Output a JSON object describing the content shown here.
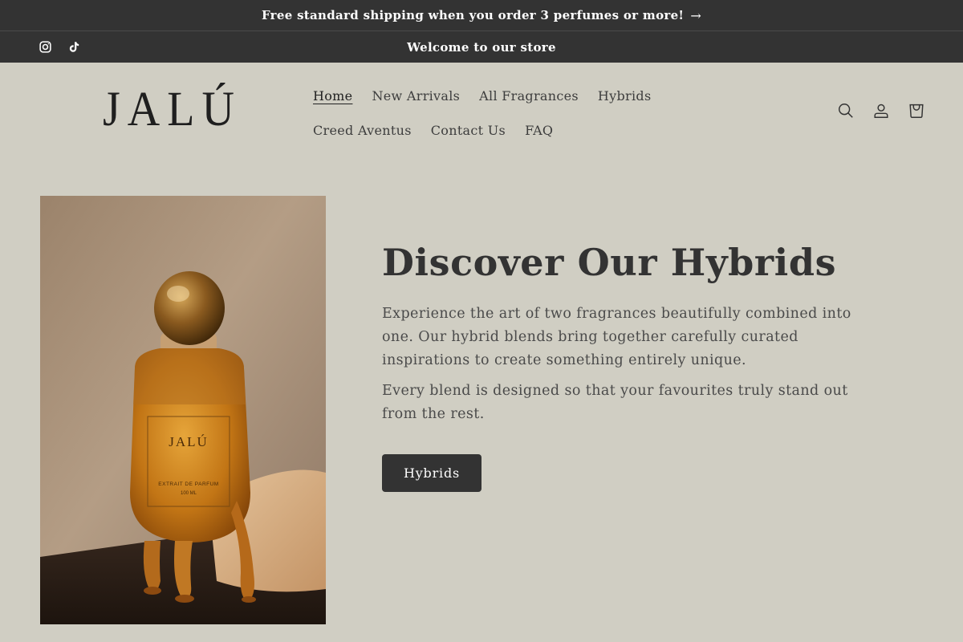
{
  "announcement": {
    "text": "Free standard shipping when you order 3 perfumes or more!",
    "arrow": "→"
  },
  "welcome_bar": {
    "text": "Welcome to our store",
    "socials": [
      "instagram-icon",
      "tiktok-icon"
    ]
  },
  "header": {
    "logo": "JALÚ",
    "nav": [
      {
        "label": "Home",
        "active": true
      },
      {
        "label": "New Arrivals"
      },
      {
        "label": "All Fragrances"
      },
      {
        "label": "Hybrids"
      },
      {
        "label": "Creed Aventus"
      },
      {
        "label": "Contact Us"
      },
      {
        "label": "FAQ"
      }
    ],
    "icons": [
      "search-icon",
      "account-icon",
      "cart-icon"
    ]
  },
  "hero": {
    "image": {
      "bottle_label": "JALÚ",
      "bottle_sublabel": "EXTRAIT DE PARFUM",
      "bottle_volume": "100 ML"
    },
    "title": "Discover Our Hybrids",
    "paragraph1": "Experience the art of two fragrances beautifully combined into one. Our hybrid blends bring together carefully curated inspirations to create something entirely unique.",
    "paragraph2": "Every blend is designed so that your favourites truly stand out from the rest.",
    "button_label": "Hybrids"
  },
  "colors": {
    "page_bg": "#d0cec3",
    "bar_bg": "#333333",
    "text": "#333333",
    "button_bg": "#333333"
  }
}
